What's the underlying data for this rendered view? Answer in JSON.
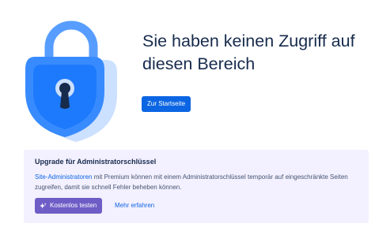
{
  "access_denied": {
    "headline": "Sie haben keinen Zugriff auf diesen Bereich",
    "home_button_label": "Zur Startseite"
  },
  "upgrade": {
    "title": "Upgrade für Administratorschlüssel",
    "desc_link": "Site-Administratoren",
    "desc_text": " mit Premium können mit einem Administratorschlüssel temporär auf eingeschränkte Seiten zugreifen, damit sie schnell Fehler beheben können.",
    "trial_button_label": "Kostenlos testen",
    "learn_more_label": "Mehr erfahren"
  },
  "icons": {
    "illustration": "padlock-icon",
    "trial_button": "sparkle-icon"
  },
  "colors": {
    "primary": "#0c66e4",
    "discovery": "#6e5dc6",
    "panel_background": "#f3f0ff",
    "lock_body": "#388bff",
    "lock_shackle": "#579dff",
    "lock_light": "#cce0ff"
  }
}
